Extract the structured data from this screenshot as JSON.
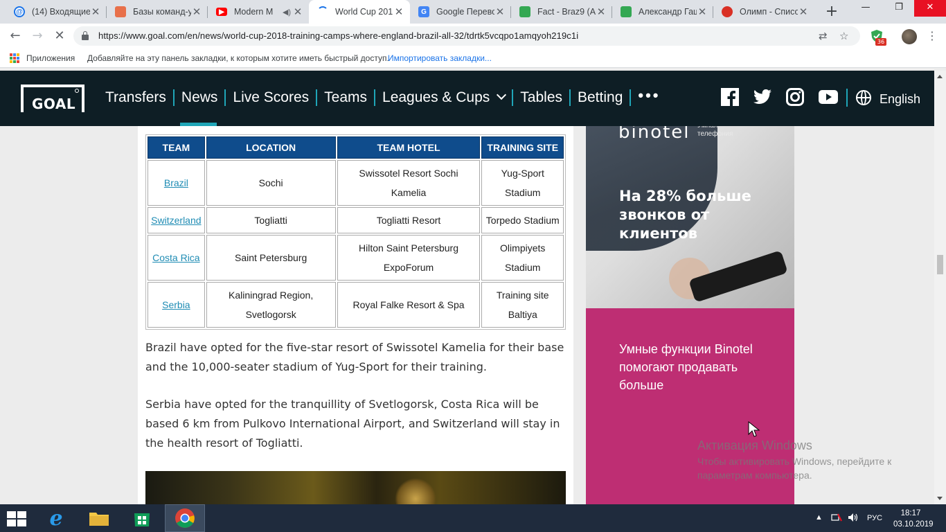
{
  "browser": {
    "tabs": [
      {
        "label": "(14) Входящие",
        "favicon": "mail-icon",
        "color": "#1a73e8",
        "active": false
      },
      {
        "label": "Базы команд-у",
        "favicon": "db-icon",
        "color": "#e8704a",
        "active": false
      },
      {
        "label": "Modern M",
        "favicon": "youtube-icon",
        "color": "#ff0000",
        "active": false
      },
      {
        "label": "World Cup 201",
        "favicon": "loading-icon",
        "color": "#1a73e8",
        "active": true
      },
      {
        "label": "Google Перево",
        "favicon": "translate-icon",
        "color": "#4285f4",
        "active": false
      },
      {
        "label": "Fact - Braz9 (Al",
        "favicon": "sheets-icon",
        "color": "#34a853",
        "active": false
      },
      {
        "label": "Александр Гаш",
        "favicon": "sheets-icon",
        "color": "#34a853",
        "active": false
      },
      {
        "label": "Олимп - Списо",
        "favicon": "olimp-icon",
        "color": "#d93025",
        "active": false
      }
    ],
    "url": "https://www.goal.com/en/news/world-cup-2018-training-camps-where-england-brazil-all-32/tdrtk5vcqpo1amqyoh219c1i",
    "extension_badge": "36",
    "bookmarks": {
      "apps_label": "Приложения",
      "hint": "Добавляйте на эту панель закладки, к которым хотите иметь быстрый доступ.",
      "import_link": "Импортировать закладки..."
    }
  },
  "site": {
    "logo": "GOAL",
    "nav": [
      "Transfers",
      "News",
      "Live Scores",
      "Teams",
      "Leagues & Cups",
      "Tables",
      "Betting"
    ],
    "more": "•••",
    "language": "English",
    "social_icons": [
      "facebook-icon",
      "twitter-icon",
      "instagram-icon",
      "youtube-icon"
    ]
  },
  "table": {
    "headers": [
      "TEAM",
      "LOCATION",
      "TEAM HOTEL",
      "TRAINING SITE"
    ],
    "rows": [
      {
        "team": "Brazil",
        "location": "Sochi",
        "hotel": "Swissotel Resort Sochi Kamelia",
        "site": "Yug-Sport Stadium"
      },
      {
        "team": "Switzerland",
        "location": "Togliatti",
        "hotel": "Togliatti Resort",
        "site": "Torpedo Stadium"
      },
      {
        "team": "Costa Rica",
        "location": "Saint Petersburg",
        "hotel": "Hilton Saint Petersburg ExpoForum",
        "site": "Olimpiyets Stadium"
      },
      {
        "team": "Serbia",
        "location": "Kaliningrad Region, Svetlogorsk",
        "hotel": "Royal Falke Resort & Spa",
        "site": "Training site Baltiya"
      }
    ]
  },
  "article": {
    "paragraph1": "Brazil have opted for the five-star resort of Swissotel Kamelia for their base and the 10,000-seater stadium of Yug-Sport for their training.",
    "paragraph2": "Serbia have opted for the tranquillity of Svetlogorsk, Costa Rica will be based 6 km from Pulkovo International Airport, and Switzerland will stay in the health resort of Togliatti."
  },
  "ad": {
    "brand": "binotel",
    "brand_sub": "Умная телефония",
    "headline": "На 28% больше звонков от клиентов",
    "body": "Умные функции Binotel помогают продавать больше",
    "accent": "#be2e73"
  },
  "watermark": {
    "title": "Активация Windows",
    "text": "Чтобы активировать Windows, перейдите к параметрам компьютера."
  },
  "taskbar": {
    "language": "РУС",
    "time": "18:17",
    "date": "03.10.2019"
  }
}
